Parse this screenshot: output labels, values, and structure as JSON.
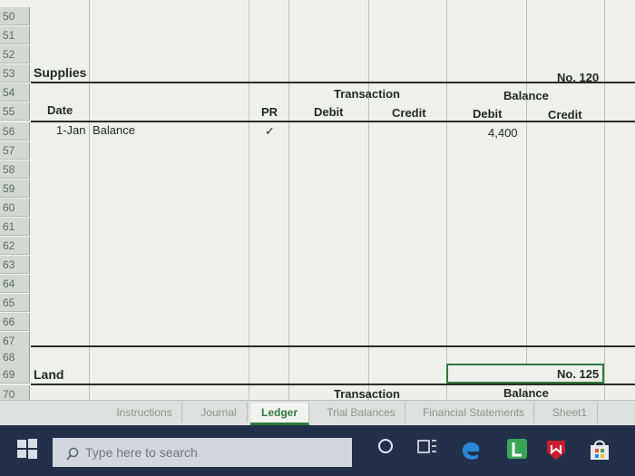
{
  "rows_top": [
    "50",
    "51",
    "52"
  ],
  "supplies": {
    "row53": "53",
    "title": "Supplies",
    "account_no": "No. 120",
    "row54": "54",
    "transaction": "Transaction",
    "balance": "Balance",
    "row55": "55",
    "date": "Date",
    "pr": "PR",
    "debit1": "Debit",
    "credit1": "Credit",
    "debit2": "Debit",
    "credit2": "Credit",
    "row56": "56",
    "entry_date": "1-Jan",
    "entry_desc": "Balance",
    "entry_pr": "✓",
    "entry_balance_debit": "4,400"
  },
  "rows_empty": [
    "57",
    "58",
    "59",
    "60",
    "61",
    "62",
    "63",
    "64",
    "65",
    "66",
    "67",
    "68"
  ],
  "land": {
    "row69": "69",
    "title": "Land",
    "account_no": "No. 125",
    "row70": "70",
    "transaction": "Transaction",
    "balance": "Balance"
  },
  "tabs": [
    "Instructions",
    "Journal",
    "Ledger",
    "Trial Balances",
    "Financial Statements",
    "Sheet1"
  ],
  "active_tab": "Ledger",
  "taskbar": {
    "search_placeholder": "Type here to search"
  },
  "colors": {
    "accent": "#2f7a3b",
    "taskbar": "#22304a"
  }
}
